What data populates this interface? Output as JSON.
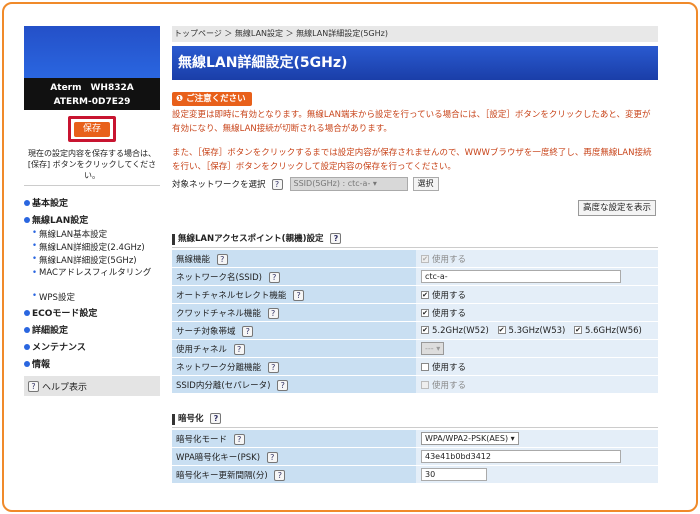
{
  "sidebar": {
    "device_model": "Aterm　WH832A",
    "device_id": "ATERM-0D7E29",
    "save_label": "保存",
    "save_note": "現在の設定内容を保存する場合は、[保存] ボタンをクリックしてください。",
    "nav": [
      {
        "label": "基本設定"
      },
      {
        "label": "無線LAN設定",
        "children": [
          "無線LAN基本設定",
          "無線LAN詳細設定(2.4GHz)",
          "無線LAN詳細設定(5GHz)",
          "MACアドレスフィルタリング",
          "WPS設定"
        ]
      },
      {
        "label": "ECOモード設定"
      },
      {
        "label": "詳細設定"
      },
      {
        "label": "メンテナンス"
      },
      {
        "label": "情報"
      }
    ],
    "help_label": "ヘルプ表示"
  },
  "main": {
    "breadcrumb": "トップページ ＞ 無線LAN設定 ＞ 無線LAN詳細設定(5GHz)",
    "title": "無線LAN詳細設定(5GHz)",
    "caution_head": "ご注意ください",
    "caution_p1": "設定変更は即時に有効となります。無線LAN端末から設定を行っている場合には、［設定］ボタンをクリックしたあと、変更が有効になり、無線LAN接続が切断される場合があります。",
    "caution_p2": "また、［保存］ボタンをクリックするまでは設定内容が保存されませんので、WWWブラウザを一度終了し、再度無線LAN接続を行い、［保存］ボタンをクリックして設定内容の保存を行ってください。",
    "target_label": "対象ネットワークを選択",
    "ssid_select_value": "SSID(5GHz) : ctc-a-",
    "select_button": "選択",
    "advanced_button": "高度な設定を表示",
    "section1": "無線LANアクセスポイント(親機)設定",
    "rows1": [
      {
        "label": "無線機能",
        "value": "使用する"
      },
      {
        "label": "ネットワーク名(SSID)",
        "value": "ctc-a-"
      },
      {
        "label": "オートチャネルセレクト機能",
        "value": "使用する"
      },
      {
        "label": "クワッドチャネル機能",
        "value": "使用する"
      },
      {
        "label": "サーチ対象帯域",
        "bands": [
          "5.2GHz(W52)",
          "5.3GHz(W53)",
          "5.6GHz(W56)"
        ]
      },
      {
        "label": "使用チャネル",
        "value": "---"
      },
      {
        "label": "ネットワーク分離機能",
        "value": "使用する"
      },
      {
        "label": "SSID内分離(セパレータ)",
        "value": "使用する"
      }
    ],
    "section2": "暗号化",
    "rows2": [
      {
        "label": "暗号化モード",
        "value": "WPA/WPA2-PSK(AES)"
      },
      {
        "label": "WPA暗号化キー(PSK)",
        "value": "43e41b0bd3412"
      },
      {
        "label": "暗号化キー更新間隔(分)",
        "value": "30"
      }
    ],
    "help_icon": "?"
  },
  "colors": {
    "accent_orange": "#e8601a",
    "title_blue": "#1a3ea8",
    "highlight_red": "#c81430",
    "caution_text": "#c8441a"
  }
}
